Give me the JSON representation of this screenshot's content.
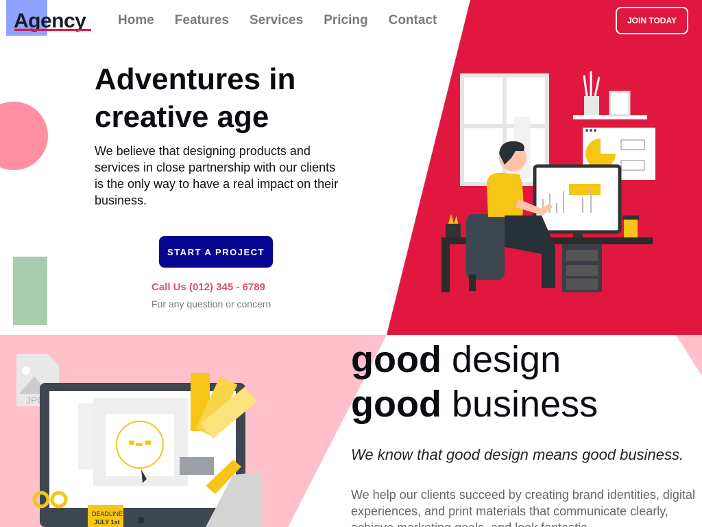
{
  "header": {
    "logo": "Agency",
    "nav": [
      {
        "label": "Home"
      },
      {
        "label": "Features"
      },
      {
        "label": "Services"
      },
      {
        "label": "Pricing"
      },
      {
        "label": "Contact"
      }
    ],
    "join_label": "JOIN TODAY"
  },
  "hero": {
    "title_line1": "Adventures in",
    "title_line2": "creative age",
    "text": "We believe that designing products and services in close partnership with our clients is the only way to have a real impact on their business.",
    "cta_label": "START A PROJECT",
    "call": "Call Us (012) 345 - 6789",
    "call_sub": "For any question or concern"
  },
  "illustrations": {
    "design_file_label": "JPG",
    "sticky_label_1": "DEADLINE",
    "sticky_label_2": "JULY 1st"
  },
  "second": {
    "line1_bold": "good",
    "line1_light": "design",
    "line2_bold": "good",
    "line2_light": "business",
    "tagline": "We know that good design means good business.",
    "desc": "We help our clients succeed by creating brand identities, digital experiences, and print materials that communicate clearly, achieve marketing goals, and look fantastic."
  },
  "colors": {
    "accent_red": "#e0183f",
    "pink": "#ffc0cb",
    "navy_button": "#050590",
    "call_text": "#e0506a"
  }
}
